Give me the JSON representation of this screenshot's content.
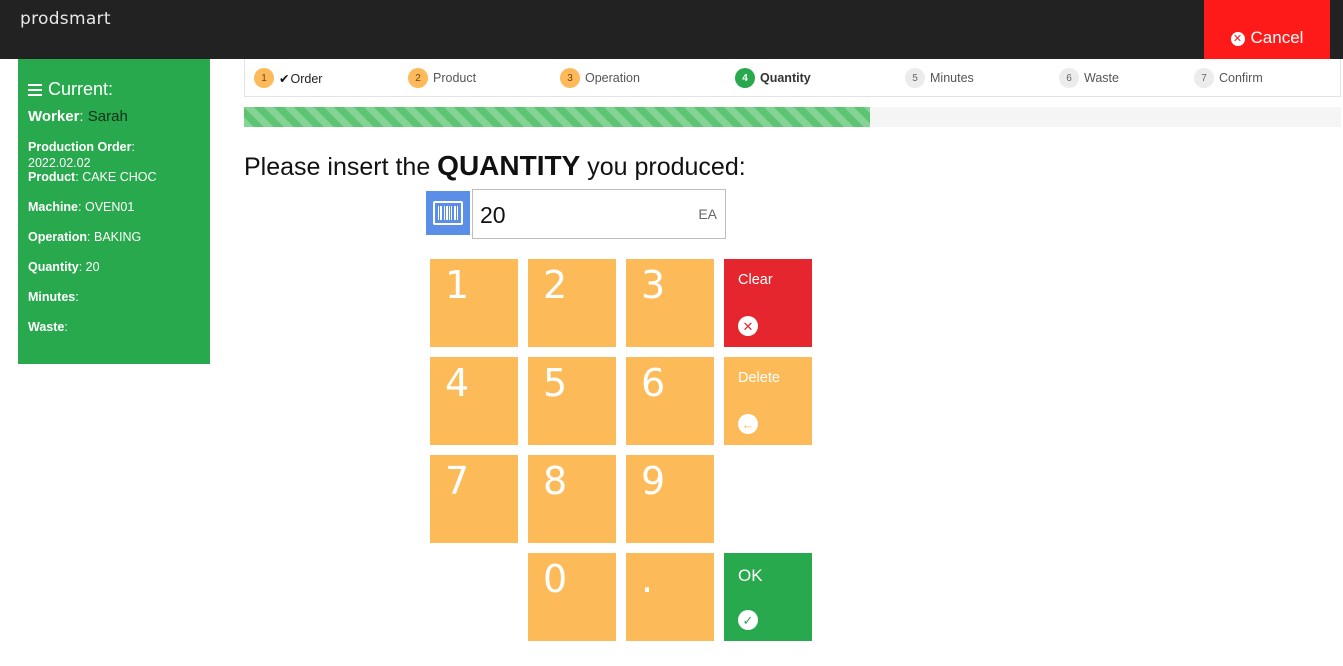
{
  "app": {
    "logo": "prodsmart",
    "cancel_label": "Cancel"
  },
  "sidebar": {
    "heading": "Current:",
    "worker_label": "Worker",
    "worker_value": "Sarah",
    "rows": [
      {
        "label": "Production Order",
        "value": "2022.02.02"
      },
      {
        "label": "Product",
        "value": "CAKE CHOC"
      },
      {
        "label": "Machine",
        "value": "OVEN01"
      },
      {
        "label": "Operation",
        "value": "BAKING"
      },
      {
        "label": "Quantity",
        "value": "20"
      },
      {
        "label": "Minutes",
        "value": ""
      },
      {
        "label": "Waste",
        "value": ""
      }
    ]
  },
  "steps": [
    {
      "num": "1",
      "label": "Order",
      "state": "done"
    },
    {
      "num": "2",
      "label": "Product",
      "state": "todo"
    },
    {
      "num": "3",
      "label": "Operation",
      "state": "todo"
    },
    {
      "num": "4",
      "label": "Quantity",
      "state": "active"
    },
    {
      "num": "5",
      "label": "Minutes",
      "state": "pending"
    },
    {
      "num": "6",
      "label": "Waste",
      "state": "pending"
    },
    {
      "num": "7",
      "label": "Confirm",
      "state": "pending"
    }
  ],
  "progress": {
    "fraction": 0.571
  },
  "prompt": {
    "before": "Please insert the",
    "emphasis": "QUANTITY",
    "after": "you produced:"
  },
  "quantity": {
    "value": "20",
    "unit": "EA"
  },
  "keypad": {
    "digits": [
      "1",
      "2",
      "3",
      "4",
      "5",
      "6",
      "7",
      "8",
      "9",
      "0",
      "."
    ],
    "clear_label": "Clear",
    "delete_label": "Delete",
    "ok_label": "OK"
  },
  "colors": {
    "green": "#28a94d",
    "orange": "#fdba58",
    "red": "#e5262e",
    "cancel_red": "#ff1a1a",
    "blue": "#5b8ee6"
  }
}
